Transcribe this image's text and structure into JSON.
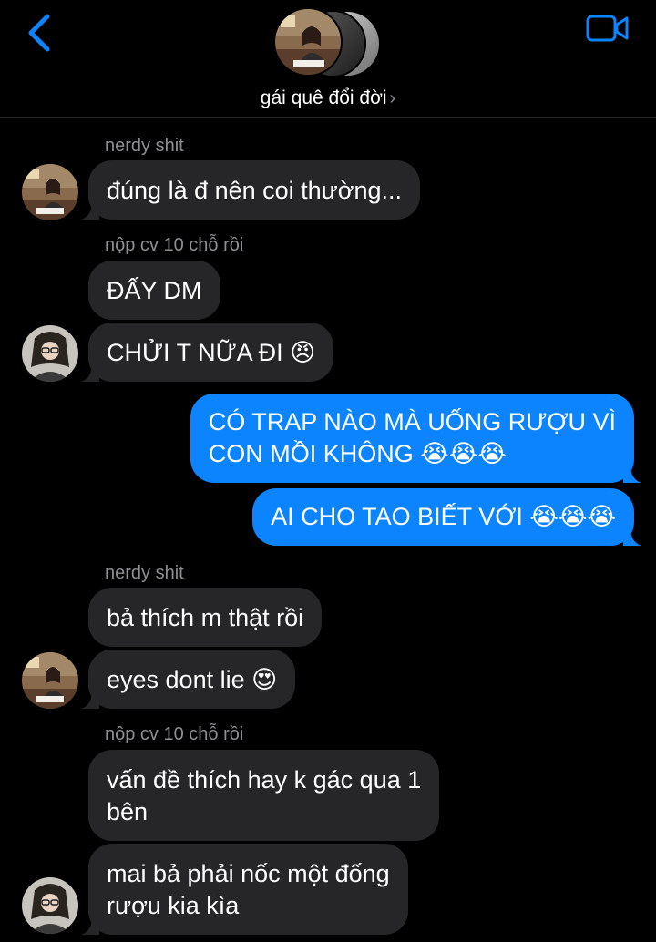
{
  "header": {
    "title": "gái quê đổi đời",
    "title_chevron": "›",
    "back_icon": "chevron-left-icon",
    "video_icon": "video-camera-icon",
    "accent": "#0b84fe"
  },
  "messages": [
    {
      "sender": "nerdy shit"
    },
    {
      "text": "đúng là đ nên coi thường..."
    },
    {
      "sender": "nộp cv 10 chỗ rồi"
    },
    {
      "text": "ĐẤY DM"
    },
    {
      "text": "CHỬI T NỮA ĐI 😠"
    },
    {
      "text": [
        "CÓ TRAP NÀO MÀ UỐNG RƯỢU VÌ",
        "CON MỒI KHÔNG 😭😭😭"
      ]
    },
    {
      "text": "AI CHO TAO BIẾT VỚI 😭😭😭"
    },
    {
      "sender": "nerdy shit"
    },
    {
      "text": "bả thích m thật rồi"
    },
    {
      "text": "eyes dont lie 😍"
    },
    {
      "sender": "nộp cv 10 chỗ rồi"
    },
    {
      "text": [
        "vấn đề thích hay k gác qua 1",
        "bên"
      ]
    },
    {
      "text": [
        "mai bả phải nốc một đống",
        "rượu kia kìa"
      ]
    }
  ],
  "colors": {
    "incoming_bubble": "#262629",
    "outgoing_bubble": "#0b84fe",
    "sender_label": "#8e8e93"
  }
}
